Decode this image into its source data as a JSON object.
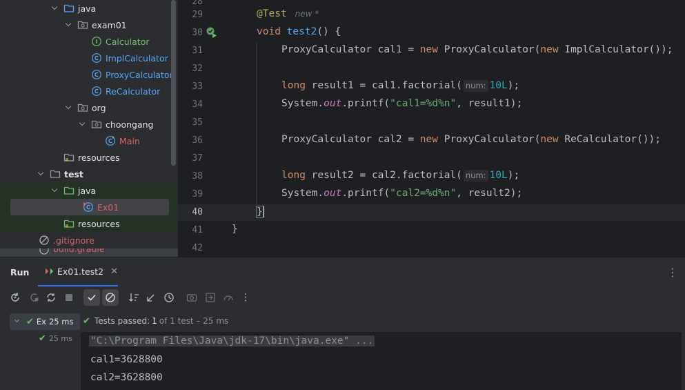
{
  "project_tree": {
    "items": [
      {
        "label": "java",
        "kind": "folder-blue",
        "expanded": true
      },
      {
        "label": "exam01",
        "kind": "package",
        "expanded": true
      },
      {
        "label": "Calculator",
        "kind": "interface"
      },
      {
        "label": "ImplCalculator",
        "kind": "class"
      },
      {
        "label": "ProxyCalculator",
        "kind": "class"
      },
      {
        "label": "ReCalculator",
        "kind": "class"
      },
      {
        "label": "org",
        "kind": "package",
        "expanded": true
      },
      {
        "label": "choongang",
        "kind": "package",
        "expanded": true
      },
      {
        "label": "Main",
        "kind": "main-class"
      },
      {
        "label": "resources",
        "kind": "resources-folder"
      },
      {
        "label": "test",
        "kind": "folder",
        "expanded": true
      },
      {
        "label": "java",
        "kind": "test-folder",
        "expanded": true
      },
      {
        "label": "Ex01",
        "kind": "test-class",
        "selected": true
      },
      {
        "label": "resources",
        "kind": "test-resources-folder"
      },
      {
        "label": ".gitignore",
        "kind": "ignored-file"
      },
      {
        "label": "build.gradle",
        "kind": "gradle-file"
      }
    ]
  },
  "editor": {
    "line_numbers": [
      "29",
      "30",
      "31",
      "32",
      "33",
      "34",
      "35",
      "36",
      "37",
      "38",
      "39",
      "40",
      "41",
      "42"
    ],
    "annotation": "@Test",
    "new_hint": "new *",
    "method_kw": "void",
    "method_name": "test2",
    "method_tail": "() {",
    "l31": {
      "a": "ProxyCalculator cal1 = ",
      "new1": "new",
      "b": " ProxyCalculator(",
      "new2": "new",
      "c": " ImplCalculator());"
    },
    "l33": {
      "kw": "long",
      "a": " result1 = cal1.factorial(",
      "hint": "num:",
      "num": "10L",
      "b": ");"
    },
    "l34": {
      "a": "System.",
      "field": "out",
      "b": ".printf(",
      "str": "\"cal1=%d%n\"",
      "c": ", result1);"
    },
    "l36": {
      "a": "ProxyCalculator cal2 = ",
      "new1": "new",
      "b": " ProxyCalculator(",
      "new2": "new",
      "c": " ReCalculator());"
    },
    "l38": {
      "kw": "long",
      "a": " result2 = cal2.factorial(",
      "hint": "num:",
      "num": "10L",
      "b": ");"
    },
    "l39": {
      "a": "System.",
      "field": "out",
      "b": ".printf(",
      "str": "\"cal2=%d%n\"",
      "c": ", result2);"
    },
    "l40": "}",
    "l41": "}"
  },
  "run_panel": {
    "title": "Run",
    "tab_label": "Ex01.test2",
    "tests": [
      {
        "label": "Ex",
        "duration": "25 ms",
        "status": "passed"
      },
      {
        "label": "",
        "duration": "25 ms",
        "status": "passed"
      }
    ],
    "status": {
      "prefix": "Tests passed:",
      "passed": "1",
      "of_text": "of 1 test – 25 ms"
    },
    "console_lines": [
      "\"C:\\Program Files\\Java\\jdk-17\\bin\\java.exe\" ...",
      "cal1=3628800",
      "cal2=3628800"
    ]
  },
  "colors": {
    "accent": "#3574f0",
    "pass": "#6ec06e",
    "keyword": "#cf8e6d",
    "function": "#56a8f5",
    "string": "#6aab73"
  }
}
